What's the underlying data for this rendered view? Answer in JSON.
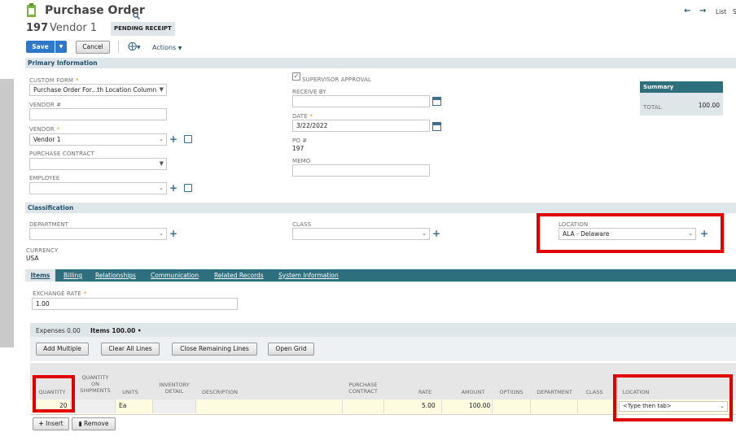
{
  "header": {
    "title": "Purchase Order",
    "record_number": "197",
    "vendor_name": "Vendor 1",
    "status": "PENDING RECEIPT",
    "nav_list": "List",
    "nav_extra": "S"
  },
  "toolbar": {
    "save": "Save",
    "cancel": "Cancel",
    "actions": "Actions"
  },
  "primary": {
    "section_title": "Primary Information",
    "custom_form_label": "CUSTOM FORM",
    "custom_form_value": "Purchase Order For...th Location Column",
    "vendor_no_label": "VENDOR #",
    "vendor_no_value": "",
    "vendor_label": "VENDOR",
    "vendor_value": "Vendor 1",
    "purchase_contract_label": "PURCHASE CONTRACT",
    "employee_label": "EMPLOYEE",
    "supervisor_approval_label": "SUPERVISOR APPROVAL",
    "receive_by_label": "RECEIVE BY",
    "date_label": "DATE",
    "date_value": "3/22/2022",
    "po_label": "PO #",
    "po_value": "197",
    "memo_label": "MEMO"
  },
  "summary": {
    "title": "Summary",
    "total_label": "TOTAL",
    "total_value": "100.00"
  },
  "classification": {
    "section_title": "Classification",
    "department_label": "DEPARTMENT",
    "class_label": "CLASS",
    "location_label": "LOCATION",
    "location_value": "ALA - Delaware",
    "currency_label": "CURRENCY",
    "currency_value": "USA"
  },
  "tabs": [
    "Items",
    "Billing",
    "Relationships",
    "Communication",
    "Related Records",
    "System Information"
  ],
  "items_tab": {
    "exchange_rate_label": "EXCHANGE RATE",
    "exchange_rate_value": "1.00",
    "subtab_expenses": "Expenses 0.00",
    "subtab_items": "Items 100.00 •",
    "buttons": [
      "Add Multiple",
      "Clear All Lines",
      "Close Remaining Lines",
      "Open Grid"
    ],
    "columns": {
      "quantity": "QUANTITY",
      "qty_on_shipments": "QUANTITY ON SHIPMENTS",
      "units": "UNITS",
      "inventory_detail": "INVENTORY DETAIL",
      "description": "DESCRIPTION",
      "purchase_contract": "PURCHASE CONTRACT",
      "rate": "RATE",
      "amount": "AMOUNT",
      "options": "OPTIONS",
      "department": "DEPARTMENT",
      "class": "CLASS",
      "location": "LOCATION"
    },
    "row": {
      "quantity": "20",
      "units": "Ea",
      "rate": "5.00",
      "amount": "100.00",
      "location_placeholder": "<Type then tab>"
    },
    "insert": "Insert",
    "remove": "Remove"
  },
  "colors": {
    "teal_bar": "#2e6f7e",
    "section_bg": "#dfe6ea",
    "save_blue": "#2f77c8",
    "highlight_red": "#e00000",
    "row_yellow": "#fffbe0"
  }
}
